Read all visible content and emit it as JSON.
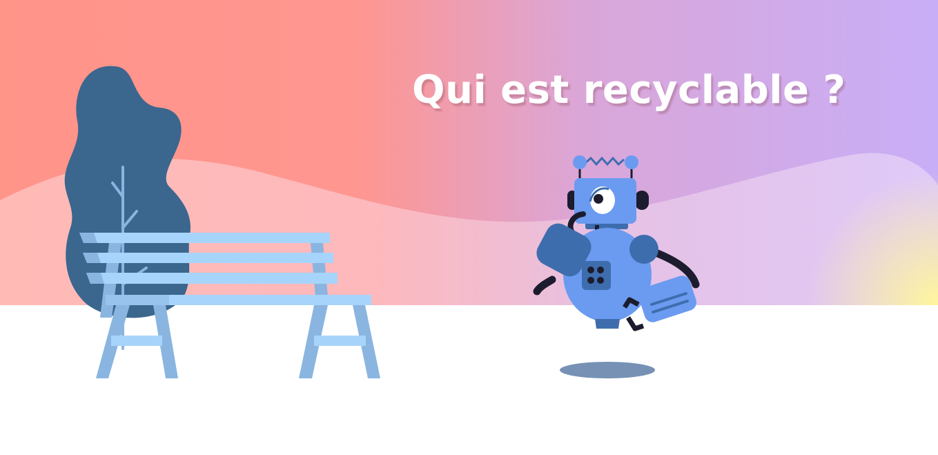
{
  "scene": {
    "title": "Qui est recyclable ?",
    "colors": {
      "sky_left": "#ff9489",
      "sky_right": "#c8aef7",
      "ground": "#ffffff",
      "tree": "#3b668e",
      "bench_slat": "#a7d4fa",
      "bench_leg": "#8ab5e0",
      "robot_body": "#6b9bf0",
      "robot_dark": "#3e6dae",
      "robot_limb": "#1c1c2e",
      "shadow": "#7691b4"
    },
    "icons": [
      "tree-icon",
      "bench-icon",
      "robot-icon"
    ]
  }
}
